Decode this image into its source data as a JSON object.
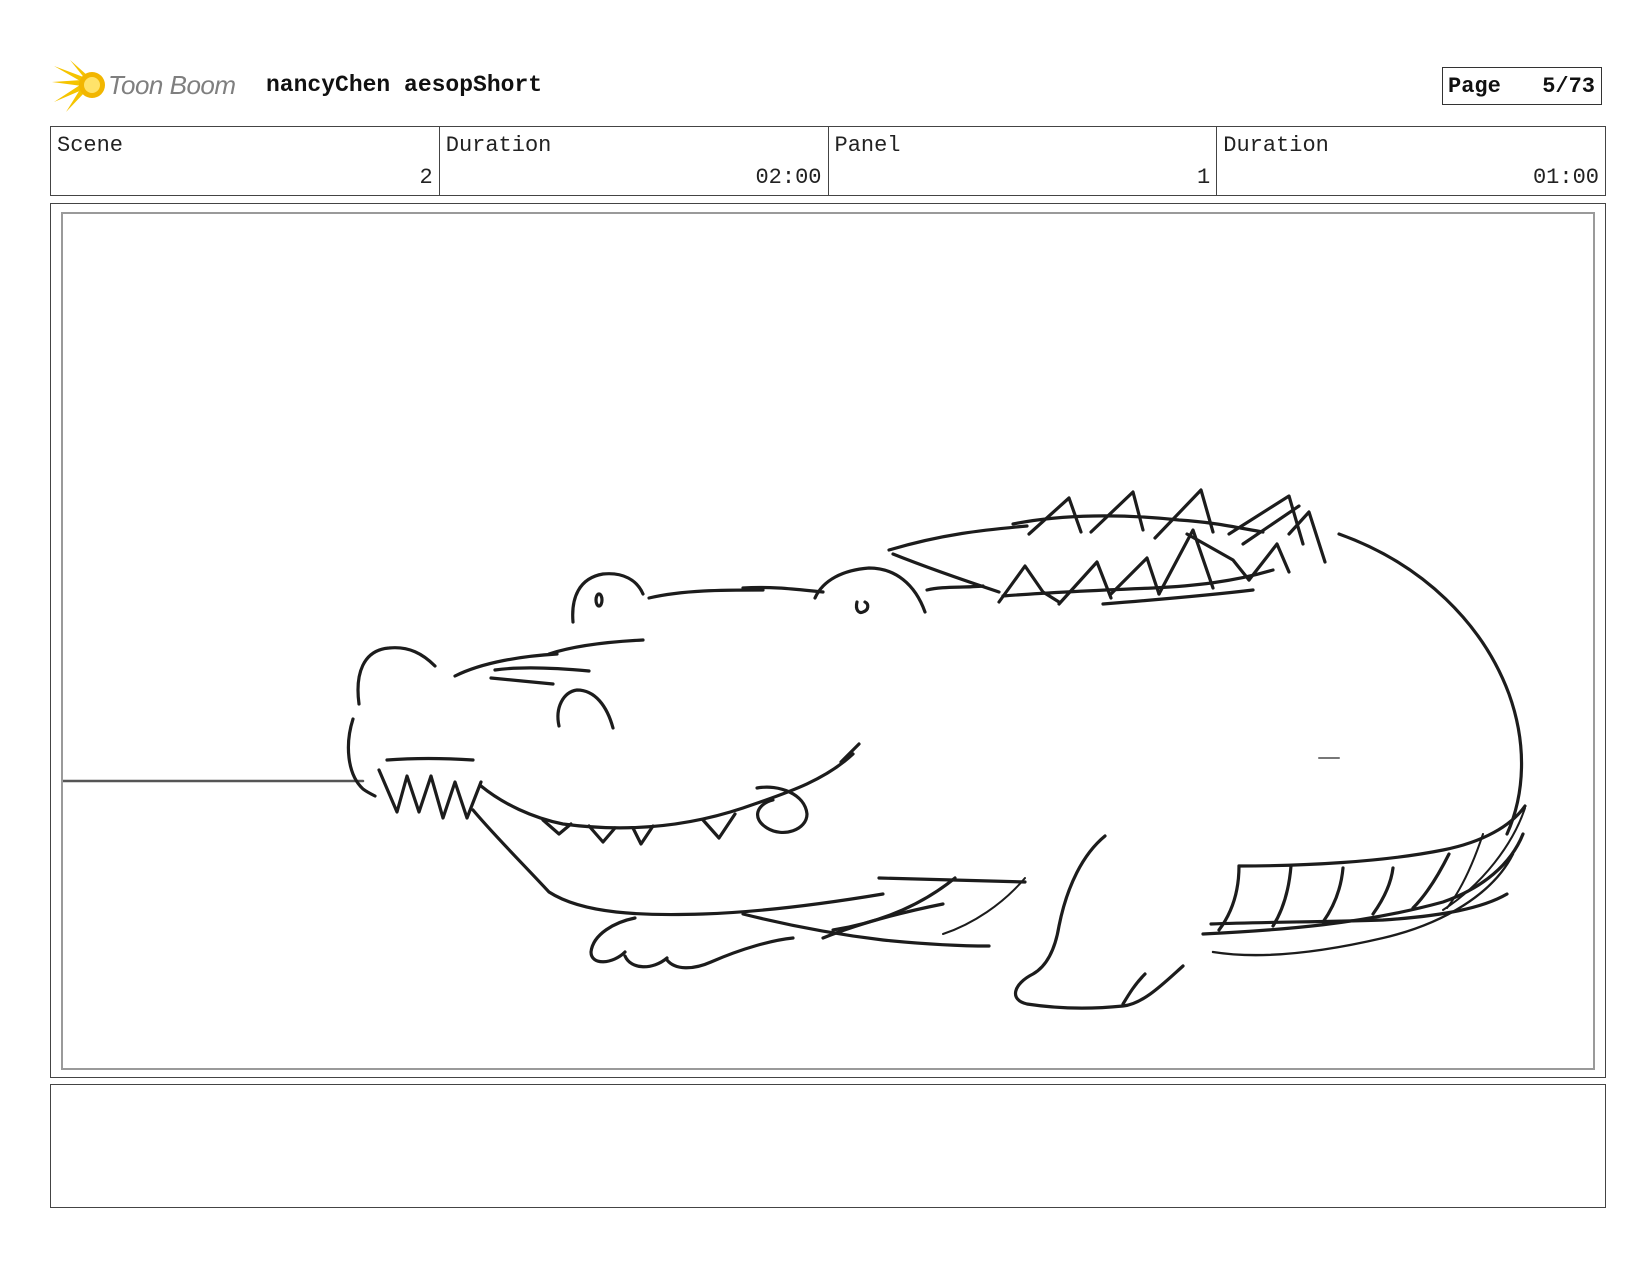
{
  "header": {
    "logo_text": "Toon Boom",
    "project_title": "nancyChen aesopShort",
    "page_label": "Page",
    "page_number": "5/73"
  },
  "info": [
    {
      "label": "Scene",
      "value": "2"
    },
    {
      "label": "Duration",
      "value": "02:00"
    },
    {
      "label": "Panel",
      "value": "1"
    },
    {
      "label": "Duration",
      "value": "01:00"
    }
  ],
  "caption": ""
}
